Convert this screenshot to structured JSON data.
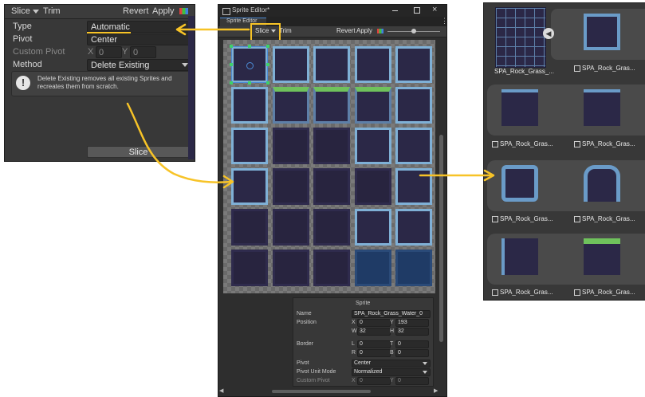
{
  "left_panel": {
    "toolbar": {
      "slice_label": "Slice",
      "trim_label": "Trim",
      "revert_label": "Revert",
      "apply_label": "Apply"
    },
    "type_label": "Type",
    "type_value": "Automatic",
    "pivot_label": "Pivot",
    "pivot_value": "Center",
    "custom_pivot_label": "Custom Pivot",
    "x_label": "X",
    "x_value": "0",
    "y_label": "Y",
    "y_value": "0",
    "method_label": "Method",
    "method_value": "Delete Existing",
    "info_text_1": "Delete Existing removes all existing Sprites and",
    "info_text_2": "recreates them from scratch.",
    "slice_button": "Slice"
  },
  "sprite_editor": {
    "window_title": "Sprite Editor*",
    "tab_label": "Sprite Editor",
    "toolbar": {
      "slice_label": "Slice",
      "trim_label": "Trim",
      "revert_label": "Revert",
      "apply_label": "Apply"
    },
    "sprite_panel": {
      "header": "Sprite",
      "name_label": "Name",
      "name_value": "SPA_Rock_Grass_Water_0",
      "position_label": "Position",
      "x_label": "X",
      "x_value": "0",
      "y_label": "Y",
      "y_value": "193",
      "w_label": "W",
      "w_value": "32",
      "h_label": "H",
      "h_value": "32",
      "border_label": "Border",
      "l_label": "L",
      "l_value": "0",
      "t_label": "T",
      "t_value": "0",
      "r_label": "R",
      "r_value": "0",
      "b_label": "B",
      "b_value": "0",
      "pivot_label": "Pivot",
      "pivot_value": "Center",
      "pivot_unit_label": "Pivot Unit Mode",
      "pivot_unit_value": "Normalized",
      "custom_pivot_label": "Custom Pivot",
      "cx_label": "X",
      "cx_value": "0",
      "cy_label": "Y",
      "cy_value": "0"
    }
  },
  "right_panel": {
    "atlas_name": "SPA_Rock_Grass_...",
    "sprite_names": [
      "SPA_Rock_Gras...",
      "SPA_Rock_Gras...",
      "SPA_Rock_Gras...",
      "SPA_Rock_Gras...",
      "SPA_Rock_Gras...",
      "SPA_Rock_Gras...",
      "SPA_Rock_Gras..."
    ]
  },
  "colors": {
    "arrow": "#f7c327",
    "panel_bg": "#383838",
    "highlight": "#f7c327"
  }
}
